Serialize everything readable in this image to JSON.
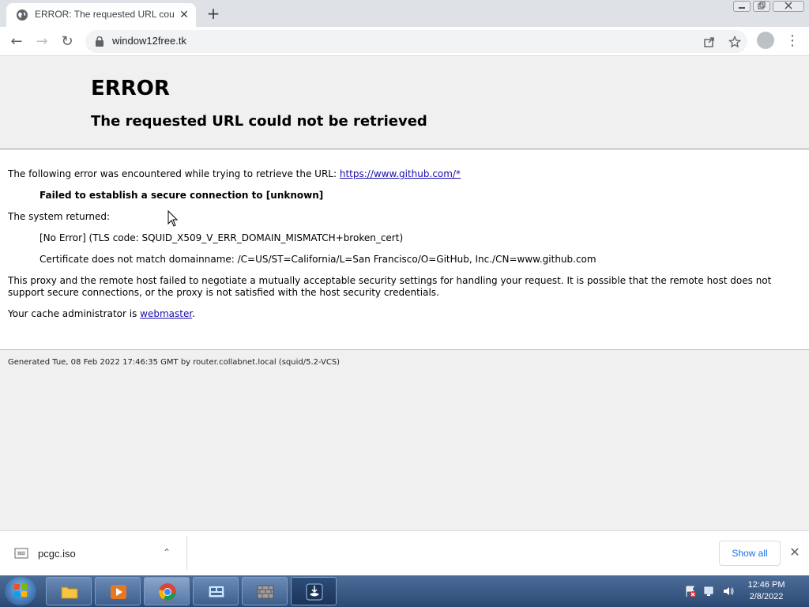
{
  "browser": {
    "tab_title": "ERROR: The requested URL could not be retrieved",
    "tab_close": "✕",
    "new_tab": "+",
    "url": "window12free.tk",
    "back": "←",
    "forward": "→",
    "reload": "↻",
    "menu": "⋮"
  },
  "page": {
    "heading": "ERROR",
    "subheading": "The requested URL could not be retrieved",
    "intro_prefix": "The following error was encountered while trying to retrieve the URL: ",
    "intro_link": "https://www.github.com/*",
    "failure": "Failed to establish a secure connection to [unknown]",
    "system_returned": "The system returned:",
    "tls_error": "[No Error] (TLS code: SQUID_X509_V_ERR_DOMAIN_MISMATCH+broken_cert)",
    "cert_mismatch": "Certificate does not match domainname: /C=US/ST=California/L=San Francisco/O=GitHub, Inc./CN=www.github.com",
    "proxy_line1": "This proxy and the remote host failed to negotiate a mutually acceptable security settings for handling your request. It is possible that the remote host does not",
    "proxy_line2": "support secure connections, or the proxy is not satisfied with the host security credentials.",
    "admin_prefix": "Your cache administrator is ",
    "admin_link": "webmaster",
    "admin_suffix": ".",
    "footer": "Generated Tue, 08 Feb 2022 17:46:35 GMT by router.collabnet.local (squid/5.2-VCS)"
  },
  "downloads": {
    "file_name": "pcgc.iso",
    "chevron": "⌃",
    "show_all": "Show all",
    "close": "✕"
  },
  "taskbar": {
    "time": "12:46 PM",
    "date": "2/8/2022"
  },
  "colors": {
    "link": "#1a0dab",
    "taskbar": "#2b4a73",
    "chrome_frame": "#dee1e6"
  }
}
